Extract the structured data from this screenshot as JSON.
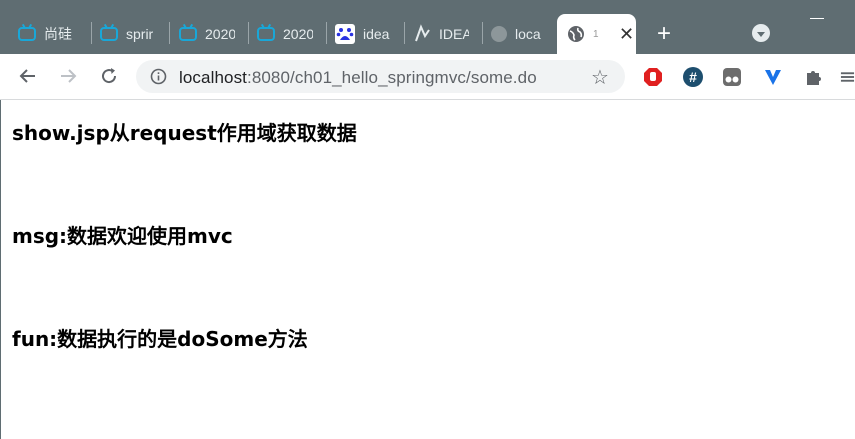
{
  "browser": {
    "tabs": [
      {
        "label": "尚硅",
        "icon": "bilibili-icon"
      },
      {
        "label": "sprir",
        "icon": "bilibili-icon"
      },
      {
        "label": "2020",
        "icon": "bilibili-icon"
      },
      {
        "label": "2020",
        "icon": "bilibili-icon"
      },
      {
        "label": "idea",
        "icon": "baidu-icon"
      },
      {
        "label": "IDEA",
        "icon": "idea-icon"
      },
      {
        "label": "loca",
        "icon": "globe-icon"
      },
      {
        "label": "1",
        "icon": "globe-icon",
        "active": true
      }
    ],
    "new_tab_symbol": "+",
    "url_host": "localhost",
    "url_path": ":8080/ch01_hello_springmvc/some.do",
    "accent": "#5f6d72"
  },
  "page": {
    "heading": "show.jsp从request作用域获取数据",
    "msg_line": "msg:数据欢迎使用mvc",
    "fun_line": "fun:数据执行的是doSome方法"
  }
}
